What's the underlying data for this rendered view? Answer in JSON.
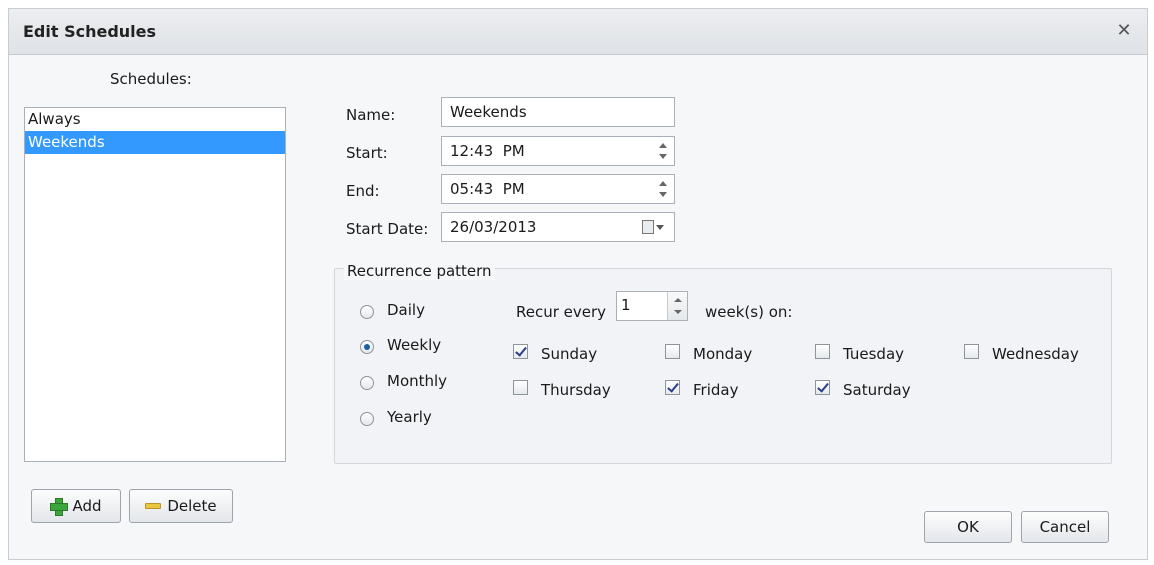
{
  "window": {
    "title": "Edit Schedules",
    "close_glyph": "✕"
  },
  "schedules": {
    "label": "Schedules:",
    "items": [
      "Always",
      "Weekends"
    ],
    "selected": "Weekends"
  },
  "buttons": {
    "add": "Add",
    "delete": "Delete",
    "ok": "OK",
    "cancel": "Cancel"
  },
  "form": {
    "name_label": "Name:",
    "name_value": "Weekends",
    "start_label": "Start:",
    "start_value": "12:43  PM",
    "end_label": "End:",
    "end_value": "05:43  PM",
    "start_date_label": "Start Date:",
    "start_date_value": "26/03/2013"
  },
  "recurrence": {
    "title": "Recurrence pattern",
    "options": [
      "Daily",
      "Weekly",
      "Monthly",
      "Yearly"
    ],
    "selected": "Weekly",
    "recur_every_label": "Recur every",
    "recur_every_value": "1",
    "weeks_on_label": "week(s) on:",
    "days": [
      {
        "label": "Sunday",
        "checked": true
      },
      {
        "label": "Monday",
        "checked": false
      },
      {
        "label": "Tuesday",
        "checked": false
      },
      {
        "label": "Wednesday",
        "checked": false
      },
      {
        "label": "Thursday",
        "checked": false
      },
      {
        "label": "Friday",
        "checked": true
      },
      {
        "label": "Saturday",
        "checked": true
      }
    ]
  },
  "icons": {
    "close": "close-icon",
    "add": "plus-icon",
    "delete": "minus-icon",
    "spin": "spinner-icon",
    "calendar": "calendar-icon"
  },
  "colors": {
    "selection": "#3399ff",
    "radio_dot": "#1b5fa8",
    "check": "#2a3e8c"
  }
}
